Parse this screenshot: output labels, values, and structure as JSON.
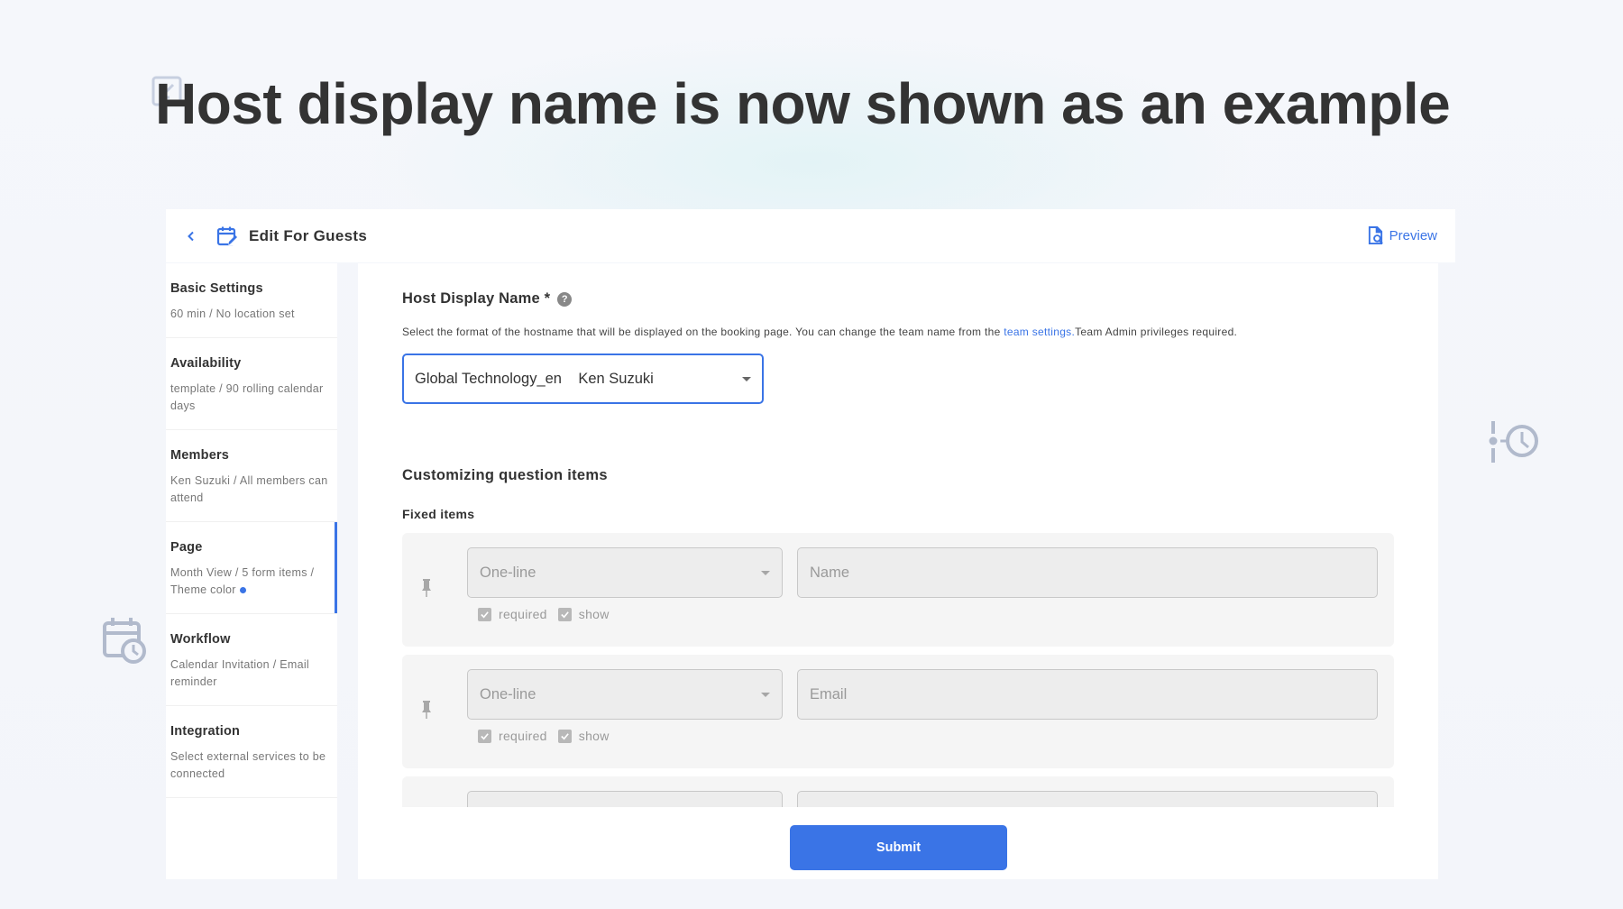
{
  "hero": {
    "title": "Host display name is now shown as an example"
  },
  "topbar": {
    "title": "Edit For Guests",
    "preview_label": "Preview"
  },
  "sidebar": {
    "items": [
      {
        "title": "Basic Settings",
        "desc": "60 min / No location set"
      },
      {
        "title": "Availability",
        "desc": "template / 90 rolling calendar days"
      },
      {
        "title": "Members",
        "desc": "Ken Suzuki / All members can attend"
      },
      {
        "title": "Page",
        "desc": "Month View / 5 form items / Theme color",
        "active": true
      },
      {
        "title": "Workflow",
        "desc": "Calendar Invitation / Email reminder"
      },
      {
        "title": "Integration",
        "desc": "Select external services to be connected"
      }
    ],
    "theme_color": "#3a74e6"
  },
  "main": {
    "host_display_name": {
      "label": "Host Display Name *",
      "help": "?",
      "desc_before": "Select the format of the hostname that will be displayed on the booking page. You can change the team name from the ",
      "desc_link": "team settings.",
      "desc_after": "Team Admin privileges required.",
      "selected_value": "Global Technology_en    Ken Suzuki"
    },
    "customizing_title": "Customizing question items",
    "fixed_items_title": "Fixed items",
    "fixed_items": [
      {
        "type": "One-line",
        "label": "Name",
        "required_label": "required",
        "show_label": "show",
        "required": true,
        "show": true
      },
      {
        "type": "One-line",
        "label": "Email",
        "required_label": "required",
        "show_label": "show",
        "required": true,
        "show": true
      },
      {
        "type": "",
        "label": ""
      }
    ],
    "submit_label": "Submit"
  },
  "colors": {
    "accent": "#3a74e6",
    "text": "#333333",
    "muted": "#777777"
  }
}
